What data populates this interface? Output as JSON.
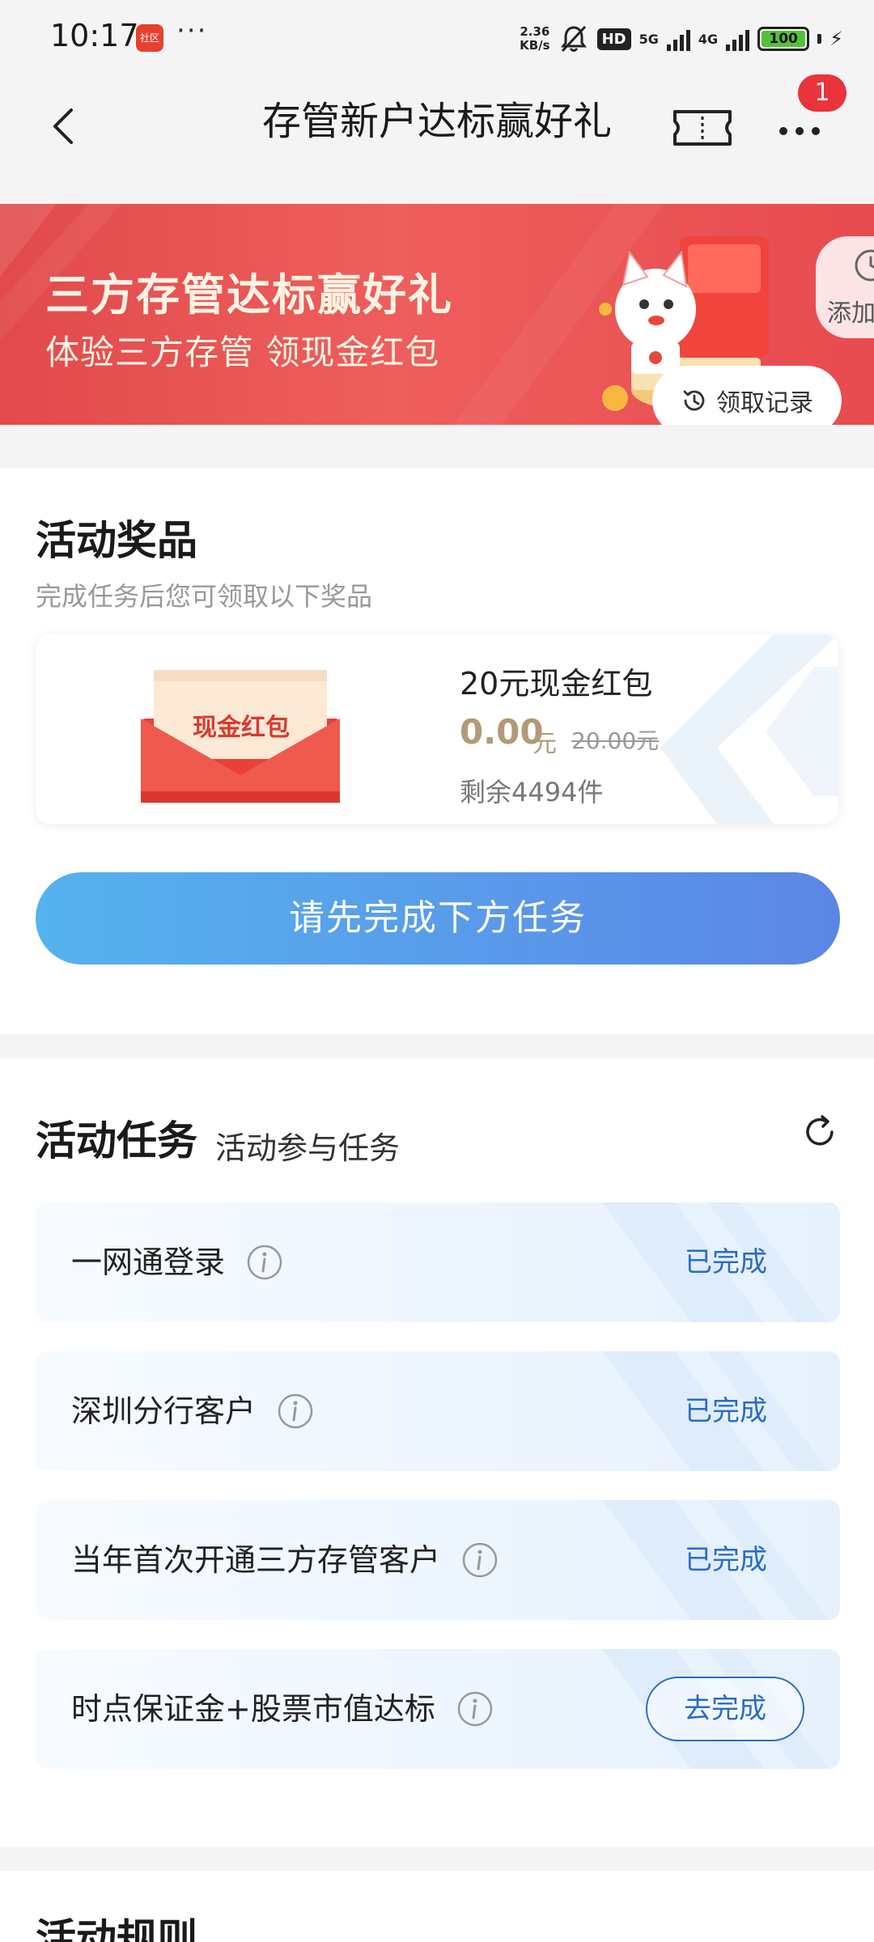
{
  "status_bar": {
    "time": "10:17",
    "app_icon_label": "社区",
    "more": "···",
    "speed_value": "2.36",
    "speed_unit": "KB/s",
    "hd_label": "HD",
    "net_5g": "5G",
    "net_4g": "4G",
    "battery": "100",
    "battery_level": 1.0,
    "icons": [
      "app-notification-icon",
      "bell-muted-icon",
      "hd-icon",
      "signal-icon",
      "battery-icon",
      "charging-icon"
    ]
  },
  "navbar": {
    "title": "存管新户达标赢好礼",
    "badge_count": "1",
    "icons": [
      "back-icon",
      "ticket-icon",
      "more-icon"
    ]
  },
  "banner": {
    "title": "三方存管达标赢好礼",
    "subtitle": "体验三方存管 领现金红包",
    "add_label": "添加",
    "record_label": "领取记录"
  },
  "prize_section": {
    "title": "活动奖品",
    "subtitle": "完成任务后您可领取以下奖品",
    "prize": {
      "image_label": "现金红包",
      "name": "20元现金红包",
      "price": "0.00",
      "price_unit": "元",
      "original_price": "20.00元",
      "remaining": "剩余4494件"
    },
    "cta_label": "请先完成下方任务"
  },
  "task_section": {
    "title": "活动任务",
    "subtitle": "活动参与任务",
    "tasks": [
      {
        "label": "一网通登录",
        "status": "已完成"
      },
      {
        "label": "深圳分行客户",
        "status": "已完成"
      },
      {
        "label": "当年首次开通三方存管客户",
        "status": "已完成"
      },
      {
        "label": "时点保证金+股票市值达标",
        "action": "去完成"
      }
    ]
  },
  "rules_section": {
    "title": "活动规则"
  },
  "colors": {
    "banner_red": "#e24a4c",
    "accent_blue": "#2a6bc8",
    "price_gold": "#b29a77",
    "cta_start": "#55b3ee",
    "cta_end": "#5c86e6",
    "badge_red": "#e8343a"
  }
}
